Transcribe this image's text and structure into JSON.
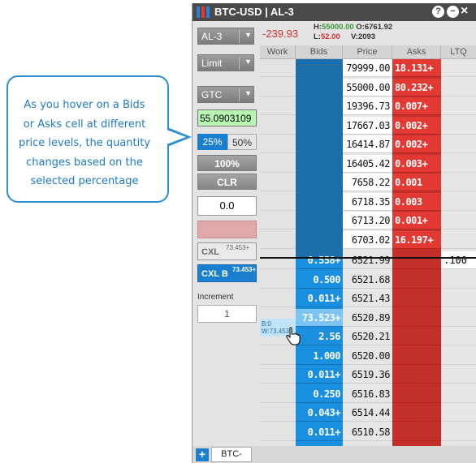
{
  "callout": {
    "lines": [
      "As you hover on a Bids",
      "or Asks cell at different",
      "price levels, the quantity",
      "changes based on the",
      "selected percentage"
    ]
  },
  "window": {
    "title": "BTC-USD | AL-3",
    "help_icon": "?",
    "minimize_icon": "−",
    "close_icon": "×"
  },
  "header": {
    "pnl": "-239.93",
    "high_label": "H:",
    "high_value": "55000.00",
    "open_label": "O:",
    "open_value": "6761.92",
    "low_label": "L:",
    "low_value": "52.00",
    "volume_label": "V:",
    "volume_value": "2093"
  },
  "controls": {
    "account": "AL-3",
    "order_type": "Limit",
    "tif": "GTC",
    "price": "55.0903109",
    "pct_25": "25%",
    "pct_50": "50%",
    "pct_100": "100%",
    "clr": "CLR",
    "quantity": "0.0",
    "disabled_btn": "",
    "cxl_label": "CXL",
    "cxl_qty": "73.453+",
    "cxlb_label": "CXL B",
    "cxlb_qty": "73.453+",
    "increment_label": "Increment",
    "increment_value": "1"
  },
  "ladder": {
    "headers": [
      "Work",
      "Bids",
      "Price",
      "Asks",
      "LTQ"
    ],
    "ask_rows": [
      {
        "price": "79999.00",
        "ask": "18.131+"
      },
      {
        "price": "55000.00",
        "ask": "80.232+"
      },
      {
        "price": "19396.73",
        "ask": "0.007+"
      },
      {
        "price": "17667.03",
        "ask": "0.002+"
      },
      {
        "price": "16414.87",
        "ask": "0.002+"
      },
      {
        "price": "16405.42",
        "ask": "0.003+"
      },
      {
        "price": "7658.22",
        "ask": "0.001"
      },
      {
        "price": "6718.35",
        "ask": "0.003"
      },
      {
        "price": "6713.20",
        "ask": "0.001+"
      },
      {
        "price": "6703.02",
        "ask": "16.197+"
      }
    ],
    "bid_rows": [
      {
        "price": "6521.99",
        "bid": "0.558+",
        "ltq": ".100"
      },
      {
        "price": "6521.68",
        "bid": "0.500",
        "ltq": ""
      },
      {
        "price": "6521.43",
        "bid": "0.011+",
        "ltq": ""
      },
      {
        "price": "6520.89",
        "bid": "73.523+",
        "ltq": ""
      },
      {
        "price": "6520.21",
        "bid": "2.56",
        "ltq": ""
      },
      {
        "price": "6520.00",
        "bid": "1.000",
        "ltq": ""
      },
      {
        "price": "6519.36",
        "bid": "0.011+",
        "ltq": ""
      },
      {
        "price": "6516.83",
        "bid": "0.250",
        "ltq": ""
      },
      {
        "price": "6514.44",
        "bid": "0.043+",
        "ltq": ""
      },
      {
        "price": "6510.58",
        "bid": "0.011+",
        "ltq": ""
      }
    ],
    "work_hover_b": "B:0",
    "work_hover_w": "W:73.453+"
  },
  "bottom": {
    "add_tab": "+",
    "symbol_tab": "BTC-USD"
  },
  "colors": {
    "accent": "#1b7fd0",
    "ask_red": "#e23a33",
    "bid_blue": "#1a8fe0",
    "price_green": "#b8f5b3"
  }
}
